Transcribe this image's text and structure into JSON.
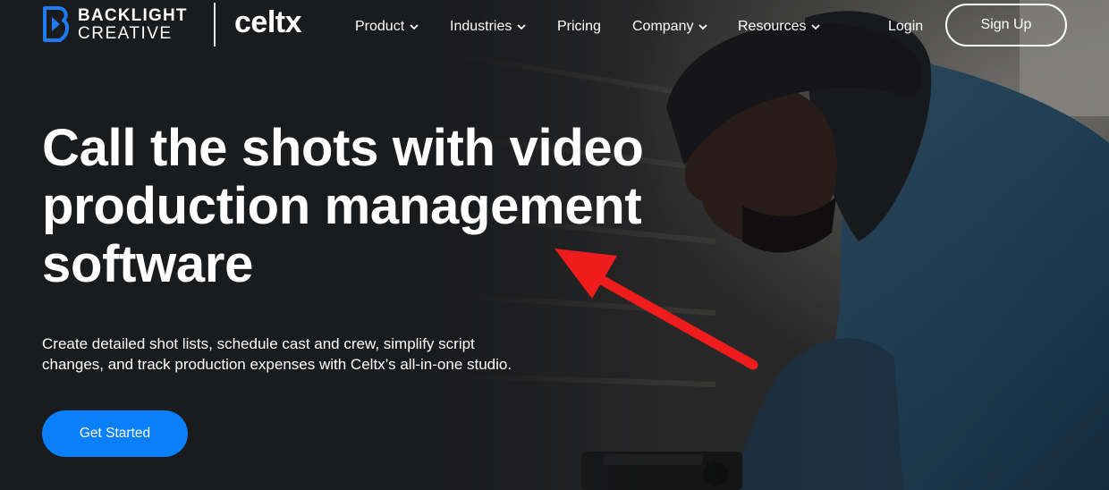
{
  "brand": {
    "backlight_line1": "BACKLIGHT",
    "backlight_line2": "CREATIVE",
    "celtx": "celtx"
  },
  "nav": {
    "items": [
      {
        "label": "Product",
        "has_dropdown": true
      },
      {
        "label": "Industries",
        "has_dropdown": true
      },
      {
        "label": "Pricing",
        "has_dropdown": false
      },
      {
        "label": "Company",
        "has_dropdown": true
      },
      {
        "label": "Resources",
        "has_dropdown": true
      }
    ],
    "login": "Login",
    "signup": "Sign Up"
  },
  "hero": {
    "headline": "Call the shots with video production management software",
    "subtext_line1": "Create detailed shot lists, schedule cast and crew, simplify script",
    "subtext_line2": "changes, and track production expenses with Celtx’s all-in-one studio.",
    "cta": "Get Started"
  },
  "colors": {
    "background": "#232427",
    "cta": "#0a7ffb",
    "brand_blue": "#1f7bf2",
    "annotation_arrow": "#ee1c1c"
  },
  "icons": {
    "nav_dropdown": "chevron-down-icon",
    "brand_mark": "backlight-logo-icon",
    "annotation": "red-arrow-annotation"
  }
}
